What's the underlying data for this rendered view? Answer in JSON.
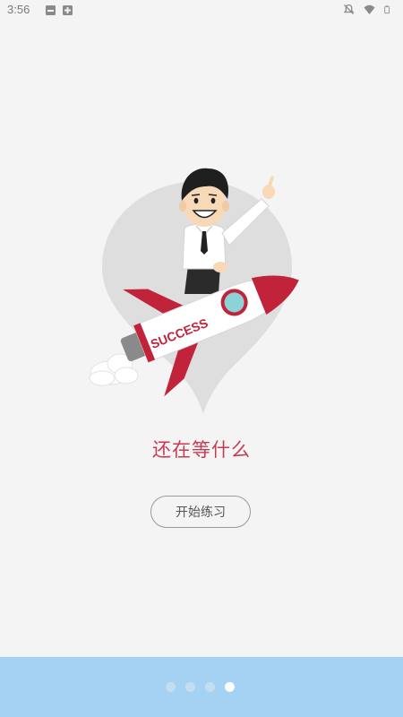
{
  "status_bar": {
    "time": "3:56",
    "left_icons": [
      "image-icon",
      "add-icon"
    ],
    "right_icons": [
      "notifications-off-icon",
      "wifi-icon",
      "battery-icon"
    ]
  },
  "illustration": {
    "rocket_label": "SUCCESS"
  },
  "headline": "还在等什么",
  "start_button_label": "开始练习",
  "pager": {
    "total": 4,
    "active_index": 3
  },
  "colors": {
    "background": "#f4f4f4",
    "accent_red": "#c53d55",
    "bottom_bar": "#a5d2f2",
    "dot_inactive": "#c3def1",
    "dot_active": "#ffffff"
  }
}
